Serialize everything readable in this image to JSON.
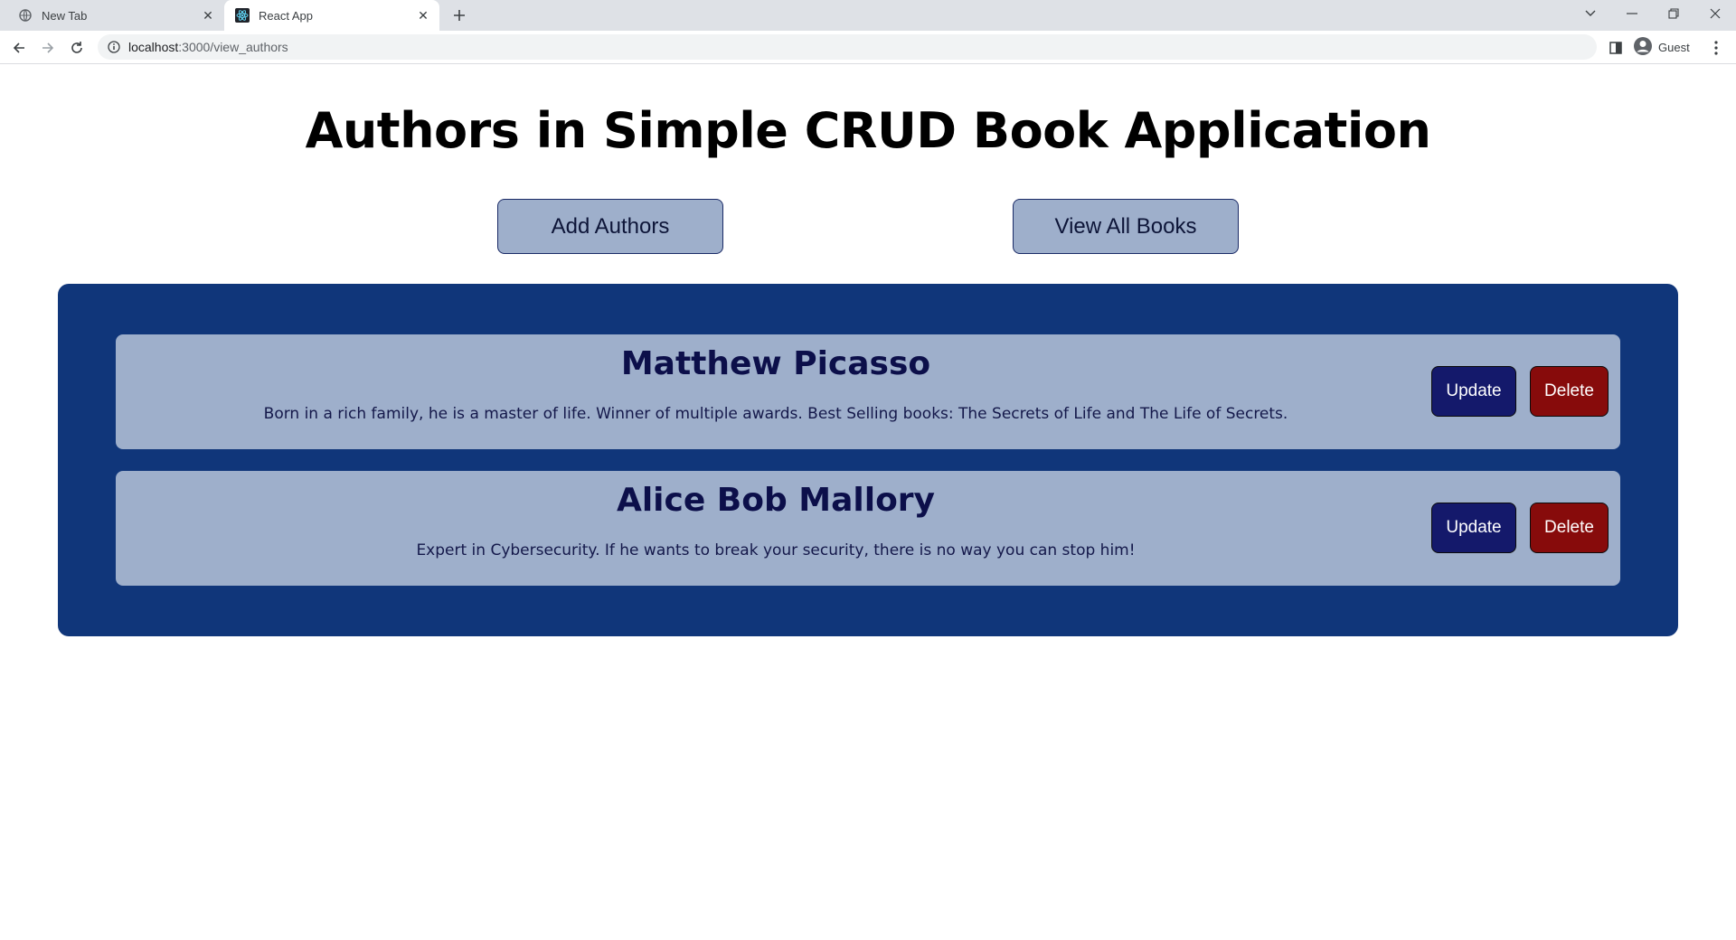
{
  "browser": {
    "tabs": [
      {
        "title": "New Tab",
        "active": false
      },
      {
        "title": "React App",
        "active": true
      }
    ],
    "url_host": "localhost",
    "url_path": ":3000/view_authors",
    "profile_label": "Guest"
  },
  "page": {
    "title": "Authors in Simple CRUD Book Application",
    "add_authors_label": "Add Authors",
    "view_books_label": "View All Books"
  },
  "authors": [
    {
      "name": "Matthew Picasso",
      "description": "Born in a rich family, he is a master of life. Winner of multiple awards. Best Selling books: The Secrets of Life and The Life of Secrets.",
      "update_label": "Update",
      "delete_label": "Delete"
    },
    {
      "name": "Alice Bob Mallory",
      "description": "Expert in Cybersecurity. If he wants to break your security, there is no way you can stop him!",
      "update_label": "Update",
      "delete_label": "Delete"
    }
  ],
  "colors": {
    "panel": "#10367a",
    "card": "#9eafcb",
    "update_button": "#14196b",
    "delete_button": "#870b0b"
  }
}
